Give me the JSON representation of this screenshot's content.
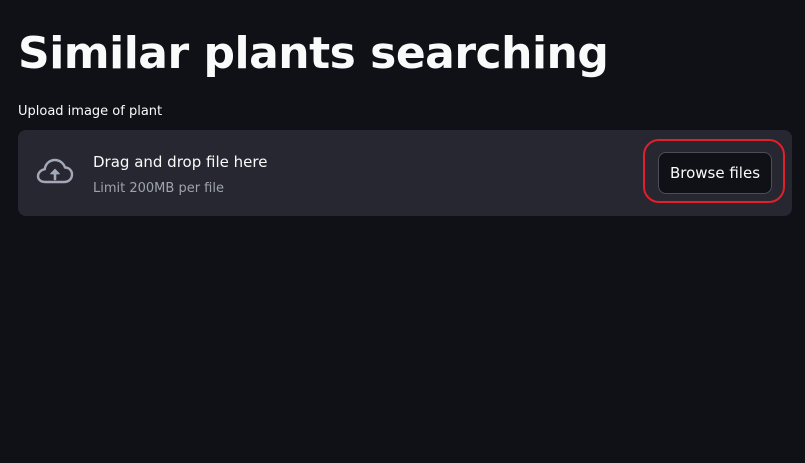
{
  "page": {
    "title": "Similar plants searching"
  },
  "uploader": {
    "label": "Upload image of plant",
    "drop_title": "Drag and drop file here",
    "limit_text": "Limit 200MB per file",
    "browse_label": "Browse files",
    "icon": "cloud-upload-icon"
  },
  "colors": {
    "background": "#0f1117",
    "dropzone": "#262730",
    "text": "#fafafa",
    "muted_text": "#9ea3ad",
    "highlight": "#e0202a"
  }
}
